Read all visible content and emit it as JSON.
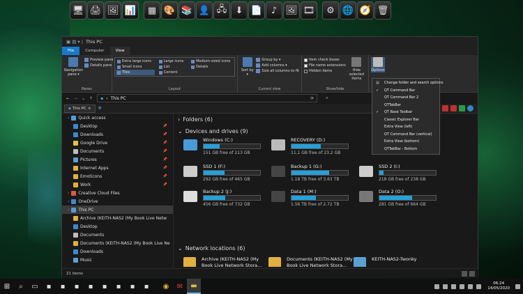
{
  "window": {
    "title": "This PC"
  },
  "tabs": [
    "File",
    "Computer",
    "View"
  ],
  "ribbon": {
    "navigation_pane": "Navigation pane ▾",
    "preview_pane": "Preview pane",
    "details_pane": "Details pane",
    "panes_label": "Panes",
    "layout": [
      "Extra large icons",
      "Large icons",
      "Medium-sized icons",
      "Small icons",
      "List",
      "Details",
      "Tiles",
      "Content"
    ],
    "layout_label": "Layout",
    "sort_by": "Sort by ▾",
    "group_by": "Group by ▾",
    "add_columns": "Add columns ▾",
    "size_columns": "Size all columns to fit",
    "current_view_label": "Current view",
    "item_check_boxes": "Item check boxes",
    "file_name_extensions": "File name extensions",
    "hidden_items": "Hidden items",
    "hide_selected": "Hide selected items",
    "show_hide_label": "Show/hide",
    "options": "Options"
  },
  "address": {
    "path": "This PC"
  },
  "qt_tab": "This PC",
  "nav": [
    {
      "label": "Quick access",
      "pin": false,
      "lvl": 0,
      "color": "#4aa0e0"
    },
    {
      "label": "Desktop",
      "pin": true,
      "lvl": 1,
      "color": "#3a8ad0"
    },
    {
      "label": "Downloads",
      "pin": true,
      "lvl": 1,
      "color": "#3a8ad0"
    },
    {
      "label": "Google Drive",
      "pin": true,
      "lvl": 1,
      "color": "#e0c040"
    },
    {
      "label": "Documents",
      "pin": true,
      "lvl": 1,
      "color": "#bbbbbb"
    },
    {
      "label": "Pictures",
      "pin": true,
      "lvl": 1,
      "color": "#5aa0d0"
    },
    {
      "label": "Internet Apps",
      "pin": true,
      "lvl": 1,
      "color": "#e0b040"
    },
    {
      "label": "Emoticons",
      "pin": true,
      "lvl": 1,
      "color": "#e0b040"
    },
    {
      "label": "Work",
      "pin": true,
      "lvl": 1,
      "color": "#e0b040"
    },
    {
      "label": "Creative Cloud Files",
      "pin": false,
      "lvl": 0,
      "color": "#e05a3a"
    },
    {
      "label": "OneDrive",
      "pin": false,
      "lvl": 0,
      "color": "#3a8ad0"
    },
    {
      "label": "This PC",
      "pin": false,
      "lvl": 0,
      "color": "#5a9ad0",
      "sel": true
    },
    {
      "label": "Archive (KEITH-NAS2 (My Book Live Netw",
      "pin": false,
      "lvl": 1,
      "color": "#e0b040"
    },
    {
      "label": "Desktop",
      "pin": false,
      "lvl": 1,
      "color": "#3a8ad0"
    },
    {
      "label": "Documents",
      "pin": false,
      "lvl": 1,
      "color": "#bbbbbb"
    },
    {
      "label": "Documents (KEITH-NAS2 (My Book Live Ne",
      "pin": false,
      "lvl": 1,
      "color": "#e0b040"
    },
    {
      "label": "Downloads",
      "pin": false,
      "lvl": 1,
      "color": "#3a8ad0"
    },
    {
      "label": "Music",
      "pin": false,
      "lvl": 1,
      "color": "#5aa0d0"
    }
  ],
  "status": {
    "items": "21 items"
  },
  "sections": {
    "folders": "Folders (6)",
    "devices": "Devices and drives (9)",
    "network": "Network locations (6)"
  },
  "drives": [
    {
      "name": "Windows (C:)",
      "free": "151 GB free of 213 GB",
      "fill": 0.29,
      "color": "#4a9ad8"
    },
    {
      "name": "RECOVERY (D:)",
      "free": "11.1 GB free of 23.2 GB",
      "fill": 0.52,
      "color": "#bbbbbb"
    },
    {
      "name": "SSD 1 (F:)",
      "free": "292 GB free of 465 GB",
      "fill": 0.37,
      "color": "#cccccc"
    },
    {
      "name": "Backup 1 (G:)",
      "free": "1.18 TB free of 3.63 TB",
      "fill": 0.67,
      "color": "#444444"
    },
    {
      "name": "SSD 2 (I:)",
      "free": "218 GB free of 238 GB",
      "fill": 0.08,
      "color": "#cccccc"
    },
    {
      "name": "Backup 2 (J:)",
      "free": "456 GB free of 732 GB",
      "fill": 0.38,
      "color": "#dddddd"
    },
    {
      "name": "Data 1 (M:)",
      "free": "1.56 TB free of 2.72 TB",
      "fill": 0.43,
      "color": "#444444"
    },
    {
      "name": "Data 2 (O:)",
      "free": "281 GB free of 664 GB",
      "fill": 0.58,
      "color": "#777777"
    }
  ],
  "network": [
    {
      "l1": "Archive (KEITH-NAS2 (My",
      "l2": "Book Live Network Stora...",
      "color": "#e0b040"
    },
    {
      "l1": "Documents (KEITH-NAS2 (My",
      "l2": "Book Live Network Stora...",
      "color": "#e0b040"
    },
    {
      "l1": "KEITH-NAS2-Twonky",
      "l2": "",
      "color": "#5aa0d0"
    },
    {
      "l1": "Music (KEITH-NAS2 (My",
      "l2": "Book Live Network Stora...",
      "color": "#e0b040"
    },
    {
      "l1": "Pictures (KEITH-NAS2 (My",
      "l2": "Book Live Network Stora...",
      "color": "#e0b040"
    },
    {
      "l1": "Videos (KEITH-NAS2 (My",
      "l2": "Book Live Network Stora...",
      "color": "#e0b040"
    }
  ],
  "menu": [
    {
      "label": "Change folder and search options",
      "checked": false
    },
    {
      "label": "QT Command Bar",
      "checked": true
    },
    {
      "label": "QT Command Bar 2",
      "checked": false
    },
    {
      "label": "QTTabBar",
      "checked": false
    },
    {
      "label": "QT Base Toolbar",
      "checked": true
    },
    {
      "label": "Classic Explorer Bar",
      "checked": false
    },
    {
      "label": "Extra View (left)",
      "checked": false
    },
    {
      "label": "QT Command Bar (vertical)",
      "checked": false
    },
    {
      "label": "Extra View (bottom)",
      "checked": false
    },
    {
      "label": "QTTabBar - Bottom",
      "checked": false
    }
  ],
  "clock": {
    "time": "06:24",
    "date": "14/05/2020"
  }
}
